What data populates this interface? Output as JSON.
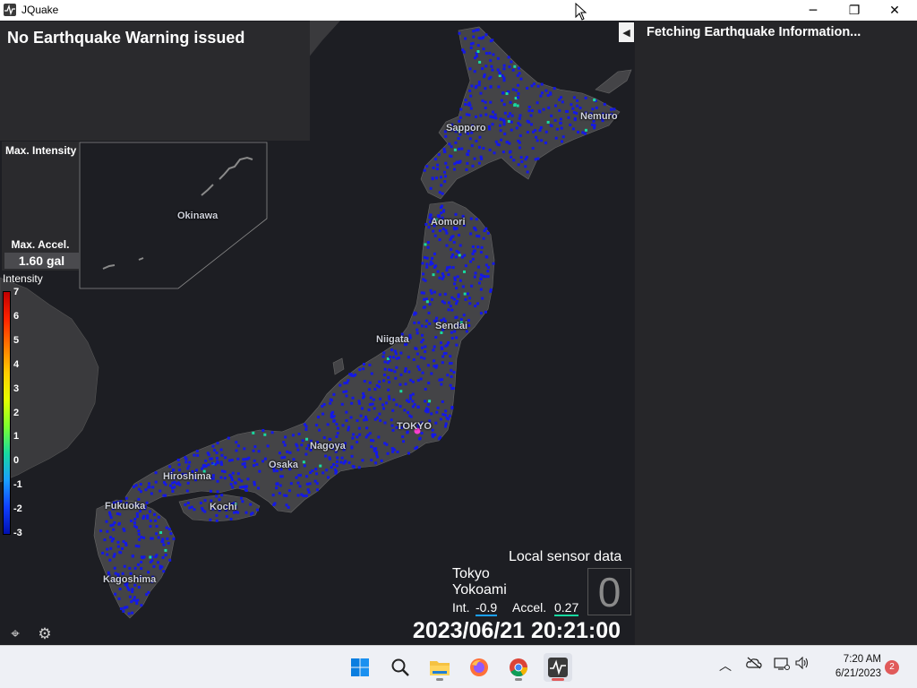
{
  "window": {
    "title": "JQuake",
    "controls": {
      "minimize": "─",
      "maximize": "❐",
      "close": "✕"
    }
  },
  "warning": {
    "text": "No Earthquake Warning issued"
  },
  "max_intensity": {
    "label": "Max. Intensity"
  },
  "max_accel": {
    "label": "Max. Accel.",
    "value": "1.60 gal"
  },
  "intensity_scale": {
    "label": "Intensity",
    "ticks": [
      "7",
      "6",
      "5",
      "4",
      "3",
      "2",
      "1",
      "0",
      "-1",
      "-2",
      "-3"
    ]
  },
  "map": {
    "cities": {
      "sapporo": "Sapporo",
      "nemuro": "Nemuro",
      "aomori": "Aomori",
      "sendai": "Sendai",
      "niigata": "Niigata",
      "tokyo": "TOKYO",
      "nagoya": "Nagoya",
      "osaka": "Osaka",
      "hiroshima": "Hiroshima",
      "kochi": "Kochi",
      "fukuoka": "Fukuoka",
      "kagoshima": "Kagoshima",
      "okinawa": "Okinawa"
    },
    "colors": {
      "land": "#444447",
      "sea": "#1d1e23",
      "sensor": "#1418e8",
      "sensor_active": "#18d9a0",
      "epicenter": "#ff3fd0"
    }
  },
  "right_panel": {
    "status": "Fetching Earthquake Information...",
    "collapse_icon": "◀"
  },
  "sensor": {
    "title": "Local sensor data",
    "location_line1": "Tokyo",
    "location_line2": "Yokoami",
    "int_label": "Int.",
    "int_value": "-0.9",
    "accel_label": "Accel.",
    "accel_value": "0.27",
    "intensity_digit": "0"
  },
  "clock": {
    "datetime": "2023/06/21 20:21:00"
  },
  "map_buttons": {
    "locate_icon": "⌖",
    "settings_icon": "⚙"
  },
  "taskbar": {
    "time": "7:20 AM",
    "date": "6/21/2023",
    "notifications": "2",
    "apps": [
      "start",
      "search",
      "file-explorer",
      "firefox",
      "chrome",
      "jquake"
    ]
  }
}
